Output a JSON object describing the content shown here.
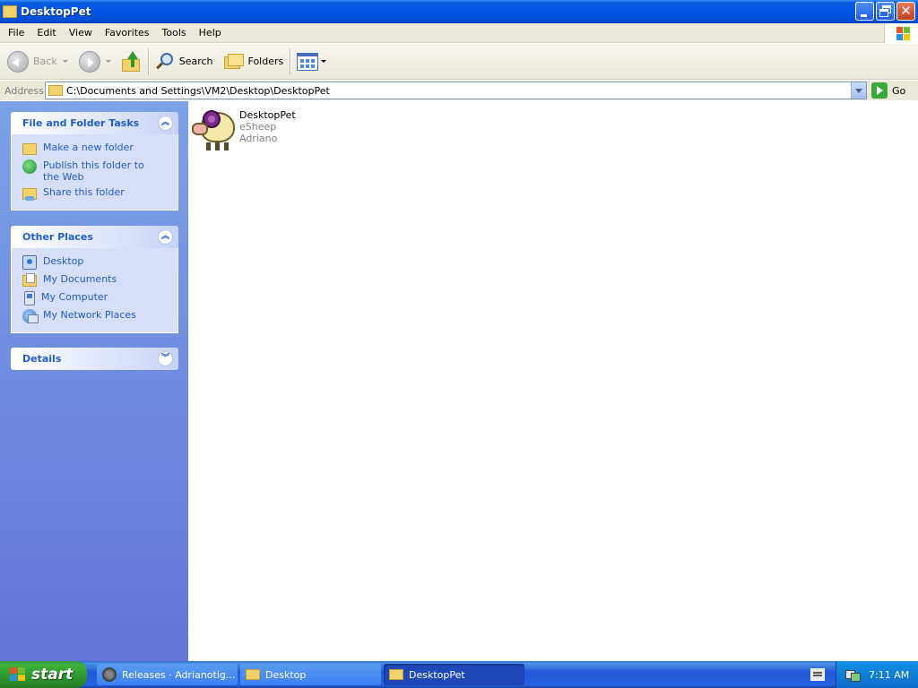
{
  "window": {
    "title": "DesktopPet"
  },
  "menubar": {
    "items": [
      "File",
      "Edit",
      "View",
      "Favorites",
      "Tools",
      "Help"
    ]
  },
  "toolbar": {
    "back_label": "Back",
    "search_label": "Search",
    "folders_label": "Folders"
  },
  "address": {
    "label": "Address",
    "value": "C:\\Documents and Settings\\VM2\\Desktop\\DesktopPet",
    "go_label": "Go"
  },
  "taskpane": {
    "file_tasks": {
      "title": "File and Folder Tasks",
      "items": [
        "Make a new folder",
        "Publish this folder to the Web",
        "Share this folder"
      ]
    },
    "other_places": {
      "title": "Other Places",
      "items": [
        "Desktop",
        "My Documents",
        "My Computer",
        "My Network Places"
      ]
    },
    "details": {
      "title": "Details"
    }
  },
  "content": {
    "files": [
      {
        "name": "DesktopPet",
        "description": "eSheep",
        "company": "Adriano",
        "icon": "sheep-icon"
      }
    ]
  },
  "taskbar": {
    "start_label": "start",
    "buttons": [
      {
        "label": "Releases · Adrianotig...",
        "icon": "raccoon-icon",
        "active": false
      },
      {
        "label": "Desktop",
        "icon": "folder-icon",
        "active": false
      },
      {
        "label": "DesktopPet",
        "icon": "folder-icon",
        "active": true
      }
    ],
    "clock": "7:11 AM"
  },
  "colors": {
    "titlebar": "#0054e3",
    "taskpane_link": "#215dc6",
    "taskpane_bg": "#7ba2e7",
    "start_green": "#3bb13b"
  }
}
